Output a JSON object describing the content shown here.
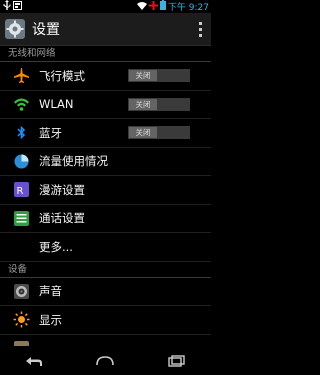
{
  "statusbar": {
    "time": "下午 9:27",
    "icons": [
      "usb-icon",
      "notification-icon",
      "wifi-icon",
      "no-sim-icon",
      "battery-icon"
    ]
  },
  "actionbar": {
    "title": "设置",
    "icon": "settings-app-icon",
    "overflow_icon": "overflow-menu-icon"
  },
  "sections": [
    {
      "header": "无线和网络",
      "items": [
        {
          "label": "飞行模式",
          "icon": "airplane-icon",
          "toggle": "关闭"
        },
        {
          "label": "WLAN",
          "icon": "wifi-icon",
          "toggle": "关闭"
        },
        {
          "label": "蓝牙",
          "icon": "bluetooth-icon",
          "toggle": "关闭"
        },
        {
          "label": "流量使用情况",
          "icon": "data-usage-icon"
        },
        {
          "label": "漫游设置",
          "icon": "roaming-icon"
        },
        {
          "label": "通话设置",
          "icon": "call-settings-icon"
        },
        {
          "label": "更多...",
          "icon": ""
        }
      ]
    },
    {
      "header": "设备",
      "items": [
        {
          "label": "声音",
          "icon": "sound-icon"
        },
        {
          "label": "显示",
          "icon": "display-icon"
        }
      ]
    }
  ],
  "navbar": {
    "back": "back-icon",
    "home": "home-icon",
    "recents": "recents-icon"
  },
  "colors": {
    "accent": "#33b5e5",
    "airplane": "#ff8a00",
    "wlan": "#36c336",
    "bluetooth": "#1e90ff"
  }
}
